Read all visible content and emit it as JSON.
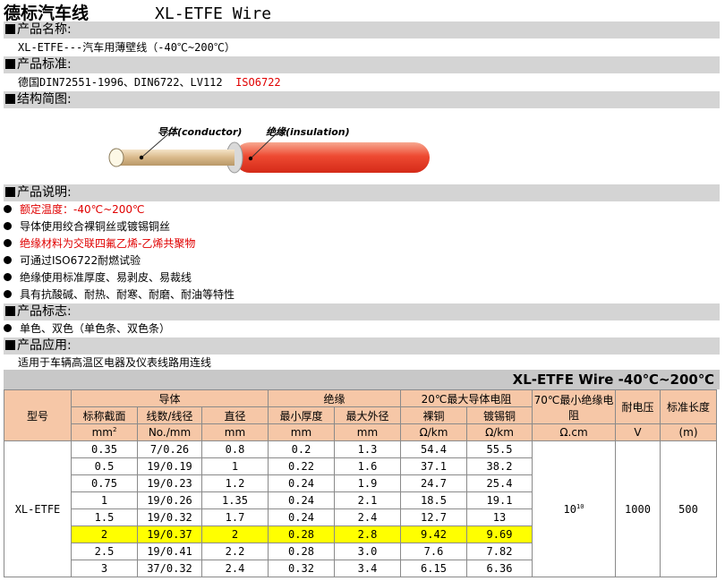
{
  "title": {
    "cn": "德标汽车线",
    "en": "XL-ETFE  Wire"
  },
  "sections": {
    "name": "产品名称:",
    "standard": "产品标准:",
    "structure": "结构简图:",
    "description": "产品说明:",
    "marking": "产品标志:",
    "application": "产品应用:"
  },
  "name_line": "XL-ETFE---汽车用薄壁线（-40℃~200℃）",
  "standard_line": {
    "main": "德国DIN72551-1996、DIN6722、LV112",
    "red": "ISO6722"
  },
  "diagram": {
    "conductor_label": "导体(conductor)",
    "insulation_label": "绝缘(insulation)"
  },
  "description_items": [
    {
      "text": "额定温度：-40℃~200℃",
      "red": true
    },
    {
      "text": "导体使用绞合裸铜丝或镀锡铜丝",
      "red": false
    },
    {
      "text": "绝缘材料为交联四氟乙烯-乙烯共聚物",
      "red": true
    },
    {
      "text": "可通过ISO6722耐燃试验",
      "red": false
    },
    {
      "text": "绝缘使用标准厚度、易剥皮、易裁线",
      "red": false
    },
    {
      "text": "具有抗酸碱、耐热、耐寒、耐磨、耐油等特性",
      "red": false
    }
  ],
  "marking_items": [
    {
      "text": "单色、双色（单色条、双色条）"
    }
  ],
  "application_line": "适用于车辆高温区电器及仪表线路用连线",
  "table": {
    "banner": "XL-ETFE  Wire   -40℃~200℃",
    "h_model": "型号",
    "h_conductor": "导体",
    "h_insulation": "绝缘",
    "h_resist": "20℃最大导体电阻",
    "h_ins_resist": "70℃最小绝缘电阻",
    "h_voltage": "耐电压",
    "h_length": "标准长度",
    "h_area": "标称截面",
    "h_wires": "线数/线径",
    "h_dia": "直径",
    "h_minthk": "最小厚度",
    "h_maxod": "最大外径",
    "h_bare": "裸铜",
    "h_tinned": "镀锡铜",
    "u_area": "mm",
    "u_wires": "No./mm",
    "u_dia": "mm",
    "u_minthk": "mm",
    "u_maxod": "mm",
    "u_bare": "Ω/km",
    "u_tinned": "Ω/km",
    "u_ins": "Ω.cm",
    "u_voltage": "V",
    "u_length": "(m)",
    "model": "XL-ETFE",
    "ins_resist_base": "10",
    "ins_resist_exp": "10",
    "voltage": "1000",
    "length": "500",
    "rows": [
      [
        "0.35",
        "7/0.26",
        "0.8",
        "0.2",
        "1.3",
        "54.4",
        "55.5"
      ],
      [
        "0.5",
        "19/0.19",
        "1",
        "0.22",
        "1.6",
        "37.1",
        "38.2"
      ],
      [
        "0.75",
        "19/0.23",
        "1.2",
        "0.24",
        "1.9",
        "24.7",
        "25.4"
      ],
      [
        "1",
        "19/0.26",
        "1.35",
        "0.24",
        "2.1",
        "18.5",
        "19.1"
      ],
      [
        "1.5",
        "19/0.32",
        "1.7",
        "0.24",
        "2.4",
        "12.7",
        "13"
      ],
      [
        "2",
        "19/0.37",
        "2",
        "0.28",
        "2.8",
        "9.42",
        "9.69"
      ],
      [
        "2.5",
        "19/0.41",
        "2.2",
        "0.28",
        "3.0",
        "7.6",
        "7.82"
      ],
      [
        "3",
        "37/0.32",
        "2.4",
        "0.32",
        "3.4",
        "6.15",
        "6.36"
      ]
    ]
  }
}
